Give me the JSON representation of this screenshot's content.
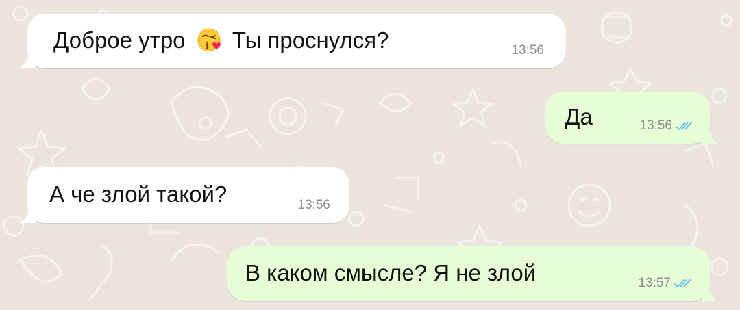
{
  "chat": {
    "background_color": "#ebe5de",
    "incoming_bubble_color": "#ffffff",
    "outgoing_bubble_color": "#e7fdd6",
    "read_receipt_color": "#4fb5f2",
    "messages": [
      {
        "direction": "incoming",
        "text_before_emoji": "Доброе утро",
        "emoji": "face-blowing-a-kiss",
        "text_after_emoji": "Ты проснулся?",
        "time": "13:56"
      },
      {
        "direction": "outgoing",
        "text": "Да",
        "time": "13:56",
        "status": "read-double-check-icon"
      },
      {
        "direction": "incoming",
        "text": "А че злой такой?",
        "time": "13:56"
      },
      {
        "direction": "outgoing",
        "text": "В каком смысле? Я не злой",
        "time": "13:57",
        "status": "read-double-check-icon"
      }
    ]
  }
}
